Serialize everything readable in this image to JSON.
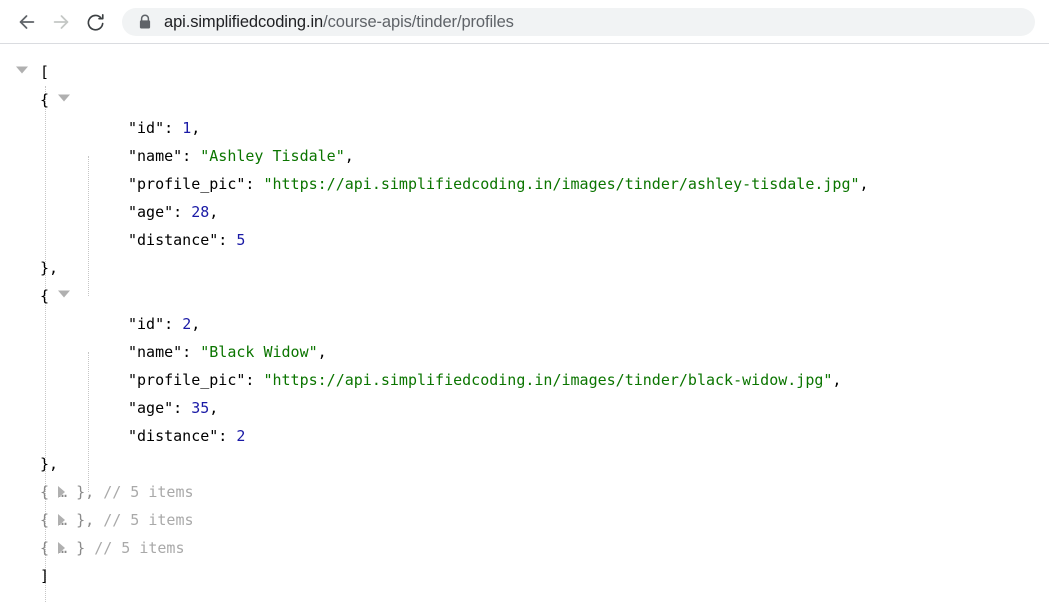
{
  "browser": {
    "back_label": "Back",
    "forward_label": "Forward",
    "reload_label": "Reload this page",
    "lock_label": "View site information",
    "url_host": "api.simplifiedcoding.in",
    "url_path": "/course-apis/tinder/profiles",
    "icons": {
      "back": "arrow-left-icon",
      "forward": "arrow-right-icon",
      "reload": "reload-icon",
      "lock": "lock-icon"
    }
  },
  "json": {
    "open_bracket": "[",
    "close_bracket": "]",
    "open_brace": "{",
    "close_brace_comma": "},",
    "collapsed_comma": "{ … },",
    "collapsed_plain": "{ … }",
    "comment_5_items": "// 5 items",
    "keys": {
      "id": "\"id\":",
      "name": "\"name\":",
      "profile_pic": "\"profile_pic\":",
      "age": "\"age\":",
      "distance": "\"distance\":"
    },
    "records": [
      {
        "id": "1",
        "name": "\"Ashley Tisdale\"",
        "profile_pic": "\"https://api.simplifiedcoding.in/images/tinder/ashley-tisdale.jpg\"",
        "age": "28",
        "distance": "5",
        "comma": ","
      },
      {
        "id": "2",
        "name": "\"Black Widow\"",
        "profile_pic": "\"https://api.simplifiedcoding.in/images/tinder/black-widow.jpg\"",
        "age": "35",
        "distance": "2",
        "comma": ","
      }
    ],
    "collapsed_rows": [
      {
        "brace": "{ … },",
        "comment": "// 5 items"
      },
      {
        "brace": "{ … },",
        "comment": "// 5 items"
      },
      {
        "brace": "{ … }",
        "comment": "// 5 items"
      }
    ]
  },
  "colors": {
    "string": "#0b7500",
    "number": "#1a1aa6",
    "key": "#000000",
    "comment": "#a9a9a9",
    "omnibox_bg": "#f1f3f4",
    "url_host": "#202124",
    "url_path": "#5f6368"
  }
}
